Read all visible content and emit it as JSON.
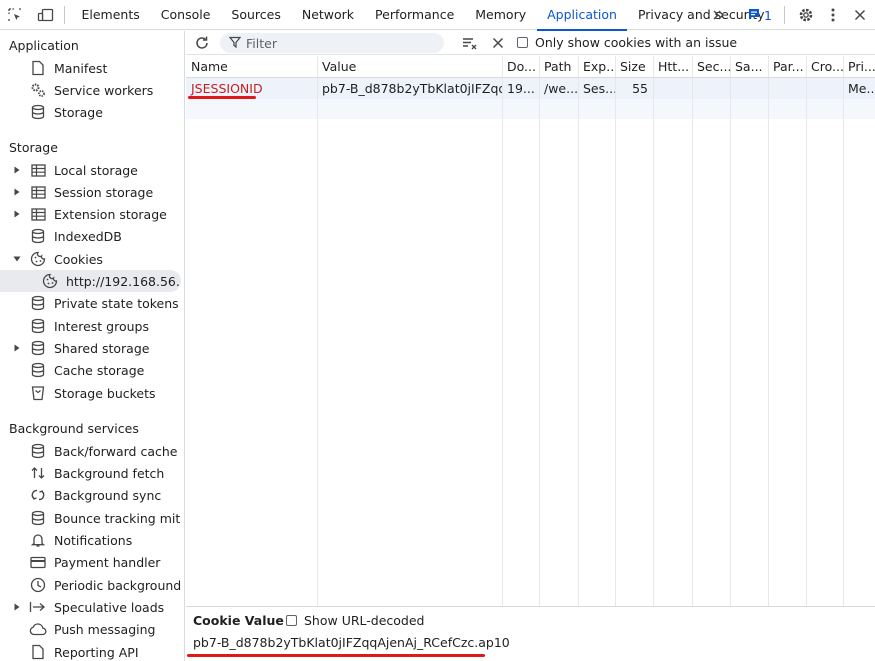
{
  "topbar": {
    "tabs": [
      {
        "label": "Elements",
        "active": false
      },
      {
        "label": "Console",
        "active": false
      },
      {
        "label": "Sources",
        "active": false
      },
      {
        "label": "Network",
        "active": false
      },
      {
        "label": "Performance",
        "active": false
      },
      {
        "label": "Memory",
        "active": false
      },
      {
        "label": "Application",
        "active": true
      },
      {
        "label": "Privacy and security",
        "active": false
      }
    ],
    "more_tabs_label": "»",
    "issues_count": "1",
    "icons": [
      "inspect-element-icon",
      "device-toolbar-icon",
      "chevron-double-right-icon",
      "issues-icon",
      "settings-icon",
      "more-vert-icon",
      "close-icon"
    ]
  },
  "sidebar": {
    "sections": {
      "application": "Application",
      "storage": "Storage",
      "background": "Background services"
    },
    "application_items": [
      {
        "label": "Manifest",
        "icon": "file-icon"
      },
      {
        "label": "Service workers",
        "icon": "gears-icon"
      },
      {
        "label": "Storage",
        "icon": "database-icon"
      }
    ],
    "storage_items": [
      {
        "label": "Local storage",
        "icon": "table-icon",
        "expandable": true
      },
      {
        "label": "Session storage",
        "icon": "table-icon",
        "expandable": true
      },
      {
        "label": "Extension storage",
        "icon": "table-icon",
        "expandable": true
      },
      {
        "label": "IndexedDB",
        "icon": "database-icon",
        "expandable": false
      },
      {
        "label": "Cookies",
        "icon": "cookie-icon",
        "expandable": true,
        "expanded": true
      },
      {
        "label": "http://192.168.56....",
        "icon": "cookie-icon",
        "child": true,
        "selected": true
      },
      {
        "label": "Private state tokens",
        "icon": "database-icon",
        "expandable": false
      },
      {
        "label": "Interest groups",
        "icon": "database-icon",
        "expandable": false
      },
      {
        "label": "Shared storage",
        "icon": "database-icon",
        "expandable": true
      },
      {
        "label": "Cache storage",
        "icon": "database-icon",
        "expandable": false
      },
      {
        "label": "Storage buckets",
        "icon": "bucket-icon",
        "expandable": false
      }
    ],
    "background_items": [
      {
        "label": "Back/forward cache",
        "icon": "database-icon"
      },
      {
        "label": "Background fetch",
        "icon": "fetch-arrows-icon"
      },
      {
        "label": "Background sync",
        "icon": "sync-icon"
      },
      {
        "label": "Bounce tracking mit...",
        "icon": "database-icon"
      },
      {
        "label": "Notifications",
        "icon": "bell-icon"
      },
      {
        "label": "Payment handler",
        "icon": "credit-card-icon"
      },
      {
        "label": "Periodic background...",
        "icon": "clock-icon"
      },
      {
        "label": "Speculative loads",
        "icon": "arrow-right-bar-icon",
        "expandable": true
      },
      {
        "label": "Push messaging",
        "icon": "cloud-icon"
      },
      {
        "label": "Reporting API",
        "icon": "file-icon"
      }
    ]
  },
  "toolbar": {
    "filter_placeholder": "Filter",
    "only_issues_label": "Only show cookies with an issue",
    "only_issues_checked": false
  },
  "cookies_table": {
    "columns": [
      "Name",
      "Value",
      "Do...",
      "Path",
      "Exp...",
      "Size",
      "Htt...",
      "Sec...",
      "Sa...",
      "Par...",
      "Cro...",
      "Pri..."
    ],
    "rows": [
      {
        "name": "JSESSIONID",
        "value": "pb7-B_d878b2yTbKlat0jIFZqq...",
        "domain": "19...",
        "path": "/we...",
        "expires": "Ses...",
        "size": "55",
        "httponly": "",
        "secure": "",
        "samesite": "",
        "partition": "",
        "crosssite": "",
        "priority": "Me..."
      }
    ]
  },
  "value_pane": {
    "title": "Cookie Value",
    "decode_label": "Show URL-decoded",
    "decode_checked": false,
    "value": "pb7-B_d878b2yTbKlat0jIFZqqAjenAj_RCefCzc.ap10"
  },
  "colors": {
    "accent": "#0b57d0",
    "annotation_red": "#e0181b",
    "selected_row": "#eef3fb"
  }
}
